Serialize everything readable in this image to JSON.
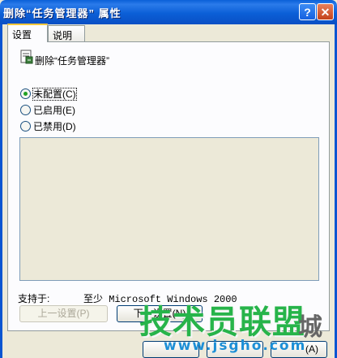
{
  "window": {
    "title": "删除“任务管理器” 属性",
    "help_glyph": "?",
    "close_glyph": "✕"
  },
  "tabs": [
    {
      "label": "设置"
    },
    {
      "label": "说明"
    }
  ],
  "policy": {
    "name": "删除“任务管理器”"
  },
  "options": [
    {
      "label": "未配置",
      "hotkey": "(C)"
    },
    {
      "label": "已启用",
      "hotkey": "(E)"
    },
    {
      "label": "已禁用",
      "hotkey": "(D)"
    }
  ],
  "support": {
    "label": "支持于:",
    "value": "至少 Microsoft Windows 2000"
  },
  "buttons": {
    "prev": "上一设置(P)",
    "next": "下一设置(N)",
    "bottom_right_hint": "(A)"
  },
  "watermark": {
    "main": "技术员联盟",
    "city": "城",
    "url": "www.jsgho.com"
  }
}
